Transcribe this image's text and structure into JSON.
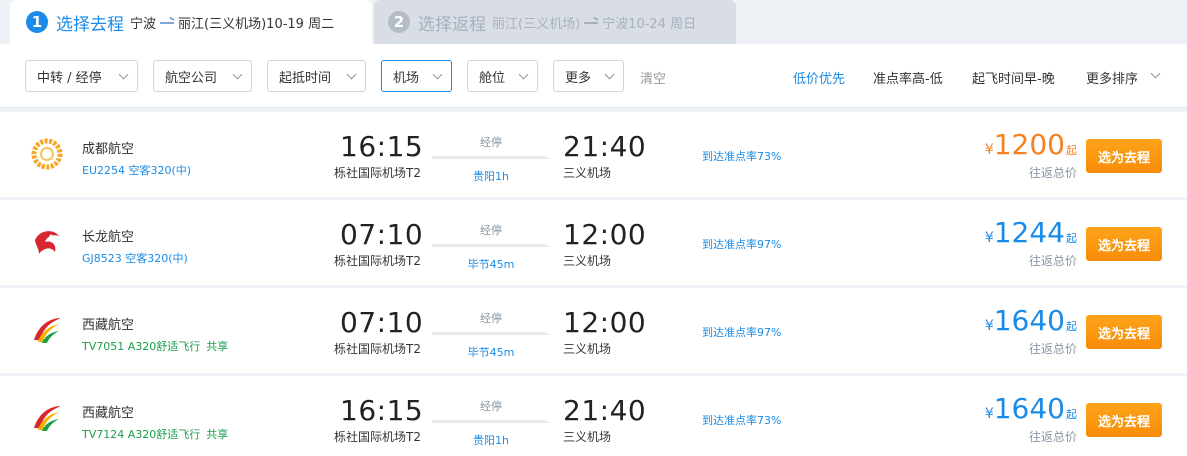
{
  "steps": [
    {
      "num": "1",
      "title": "选择去程",
      "from": "宁波",
      "to": "丽江(三义机场)",
      "date": "10-19 周二"
    },
    {
      "num": "2",
      "title": "选择返程",
      "from": "丽江(三义机场)",
      "to": "宁波",
      "date": "10-24 周日"
    }
  ],
  "filters": [
    "中转 / 经停",
    "航空公司",
    "起抵时间",
    "机场",
    "舱位",
    "更多"
  ],
  "clear_label": "清空",
  "sorts": [
    "低价优先",
    "准点率高-低",
    "起飞时间早-晚",
    "更多排序"
  ],
  "colors": {
    "accent": "#1a8be8",
    "price_orange": "#f5821f",
    "button": "#f78d0a",
    "share_green": "#1a9e4b"
  },
  "flights": [
    {
      "logo_icon": "chengdu-airlines-logo-icon",
      "airline": "成都航空",
      "flight_no": "EU2254",
      "aircraft": "空客320(中)",
      "share": "",
      "dep_time": "16:15",
      "dep_airport": "栎社国际机场T2",
      "stop_label": "经停",
      "stop_city": "贵阳1h",
      "arr_time": "21:40",
      "arr_airport": "三义机场",
      "ontime": "到达准点率73%",
      "yen": "¥",
      "price": "1200",
      "qi": "起",
      "rt_label": "往返总价",
      "button": "选为去程"
    },
    {
      "logo_icon": "loong-air-logo-icon",
      "airline": "长龙航空",
      "flight_no": "GJ8523",
      "aircraft": "空客320(中)",
      "share": "",
      "dep_time": "07:10",
      "dep_airport": "栎社国际机场T2",
      "stop_label": "经停",
      "stop_city": "毕节45m",
      "arr_time": "12:00",
      "arr_airport": "三义机场",
      "ontime": "到达准点率97%",
      "yen": "¥",
      "price": "1244",
      "qi": "起",
      "rt_label": "往返总价",
      "button": "选为去程"
    },
    {
      "logo_icon": "tibet-airlines-logo-icon",
      "airline": "西藏航空",
      "flight_no": "TV7051",
      "aircraft": "A320舒适飞行",
      "share": "共享",
      "dep_time": "07:10",
      "dep_airport": "栎社国际机场T2",
      "stop_label": "经停",
      "stop_city": "毕节45m",
      "arr_time": "12:00",
      "arr_airport": "三义机场",
      "ontime": "到达准点率97%",
      "yen": "¥",
      "price": "1640",
      "qi": "起",
      "rt_label": "往返总价",
      "button": "选为去程"
    },
    {
      "logo_icon": "tibet-airlines-logo-icon",
      "airline": "西藏航空",
      "flight_no": "TV7124",
      "aircraft": "A320舒适飞行",
      "share": "共享",
      "dep_time": "16:15",
      "dep_airport": "栎社国际机场T2",
      "stop_label": "经停",
      "stop_city": "贵阳1h",
      "arr_time": "21:40",
      "arr_airport": "三义机场",
      "ontime": "到达准点率73%",
      "yen": "¥",
      "price": "1640",
      "qi": "起",
      "rt_label": "往返总价",
      "button": "选为去程"
    }
  ]
}
